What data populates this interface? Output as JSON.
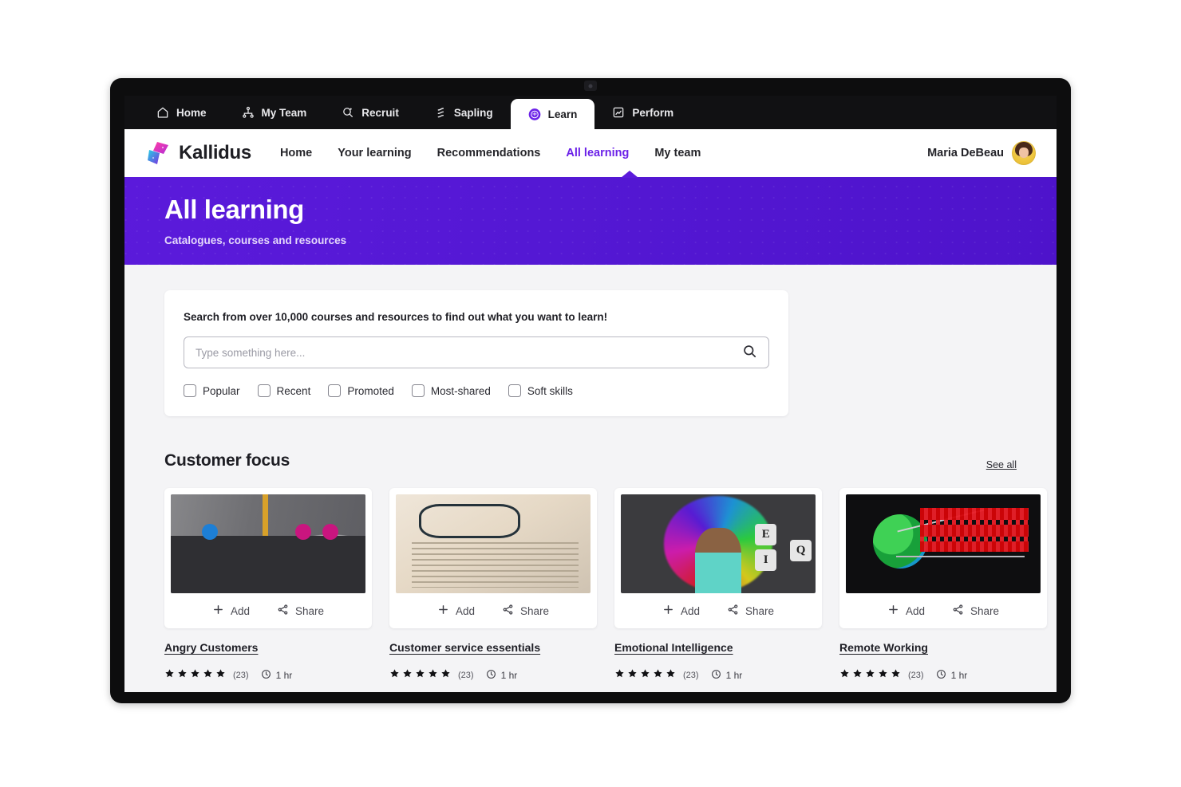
{
  "os_tabs": [
    {
      "label": "Home",
      "icon": "home-icon",
      "active": false
    },
    {
      "label": "My Team",
      "icon": "org-chart-icon",
      "active": false
    },
    {
      "label": "Recruit",
      "icon": "person-search-icon",
      "active": false
    },
    {
      "label": "Sapling",
      "icon": "layers-icon",
      "active": false
    },
    {
      "label": "Learn",
      "icon": "learn-badge-icon",
      "active": true
    },
    {
      "label": "Perform",
      "icon": "chart-icon",
      "active": false
    }
  ],
  "brand": {
    "name": "Kallidus",
    "logo_icon": "kallidus-logo-icon"
  },
  "app_nav": [
    {
      "label": "Home",
      "active": false
    },
    {
      "label": "Your learning",
      "active": false
    },
    {
      "label": "Recommendations",
      "active": false
    },
    {
      "label": "All learning",
      "active": true
    },
    {
      "label": "My team",
      "active": false
    }
  ],
  "user": {
    "name": "Maria DeBeau",
    "avatar_icon": "avatar"
  },
  "hero": {
    "title": "All learning",
    "subtitle": "Catalogues, courses and resources"
  },
  "search": {
    "heading": "Search from over 10,000 courses and resources to find out what you want to learn!",
    "placeholder": "Type something here...",
    "value": "",
    "search_icon": "search-icon",
    "filters": [
      {
        "label": "Popular",
        "checked": false
      },
      {
        "label": "Recent",
        "checked": false
      },
      {
        "label": "Promoted",
        "checked": false
      },
      {
        "label": "Most-shared",
        "checked": false
      },
      {
        "label": "Soft skills",
        "checked": false
      }
    ]
  },
  "section": {
    "title": "Customer focus",
    "see_all": "See all"
  },
  "card_actions": {
    "add": "Add",
    "share": "Share"
  },
  "courses": [
    {
      "title": "Angry Customers",
      "rating": 5,
      "rating_count": "(23)",
      "duration": "1 hr",
      "thumb": "t1"
    },
    {
      "title": "Customer service essentials",
      "rating": 5,
      "rating_count": "(23)",
      "duration": "1 hr",
      "thumb": "t2"
    },
    {
      "title": "Emotional Intelligence",
      "rating": 5,
      "rating_count": "(23)",
      "duration": "1 hr",
      "thumb": "t3"
    },
    {
      "title": "Remote Working",
      "rating": 5,
      "rating_count": "(23)",
      "duration": "1 hr",
      "thumb": "t4"
    }
  ],
  "colors": {
    "brand_purple": "#6B21E8",
    "hero_purple": "#5418D4",
    "tabstrip_black": "#111113",
    "page_bg": "#f4f4f6"
  }
}
